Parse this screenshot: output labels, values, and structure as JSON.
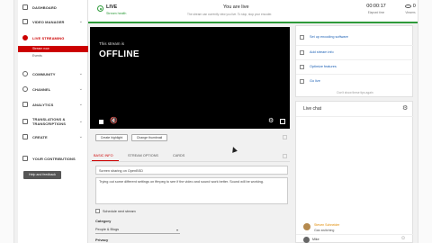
{
  "sidebar": {
    "items": [
      {
        "label": "DASHBOARD",
        "icon": "dashboard-icon"
      },
      {
        "label": "VIDEO MANAGER",
        "icon": "video-manager-icon"
      },
      {
        "label": "LIVE STREAMING",
        "icon": "live-streaming-icon"
      },
      {
        "label": "COMMUNITY",
        "icon": "community-icon"
      },
      {
        "label": "CHANNEL",
        "icon": "channel-icon"
      },
      {
        "label": "ANALYTICS",
        "icon": "analytics-icon"
      },
      {
        "label": "TRANSLATIONS & TRANSCRIPTIONS",
        "icon": "translations-icon"
      },
      {
        "label": "CREATE",
        "icon": "create-icon"
      },
      {
        "label": "YOUR CONTRIBUTIONS",
        "icon": "contributions-icon"
      }
    ],
    "sub_items": [
      "Stream now",
      "Events"
    ],
    "help_button": "Help and feedback"
  },
  "header": {
    "live_label": "LIVE",
    "stream_health": "Stream health",
    "you_are_live": "You are live",
    "live_desc": "The stream can currently view you live. To stop, stop your encoder.",
    "stats": [
      {
        "value": "00:00:17",
        "label": "Elapsed time"
      },
      {
        "value": "0",
        "label": "Viewers"
      }
    ]
  },
  "video": {
    "stream_is": "This stream is",
    "status": "OFFLINE"
  },
  "actions": {
    "highlight": "Create highlight",
    "thumbnail": "Change thumbnail"
  },
  "tabs": [
    "BASIC INFO",
    "STREAM OPTIONS",
    "CARDS"
  ],
  "form": {
    "title_value": "Screen sharing on OpenBSD",
    "description_value": "Trying out some different settings on ffmpeg to see if the video and sound work better. Sound will be working.",
    "schedule_label": "Schedule next stream",
    "category_label": "Category",
    "category_value": "People & Blogs",
    "privacy_label": "Privacy"
  },
  "right_panel": {
    "items": [
      "Set up encoding software",
      "Add stream info",
      "Optimize features",
      "Go live"
    ],
    "footer": "Don't show these tips again"
  },
  "chat": {
    "title": "Live chat",
    "message": {
      "name": "Steven Schneider",
      "text": "Gas switching"
    },
    "input_name": "Mike"
  },
  "colors": {
    "accent": "#cc0000",
    "live_green": "#2e9b3a",
    "link_blue": "#1a5fb4"
  }
}
